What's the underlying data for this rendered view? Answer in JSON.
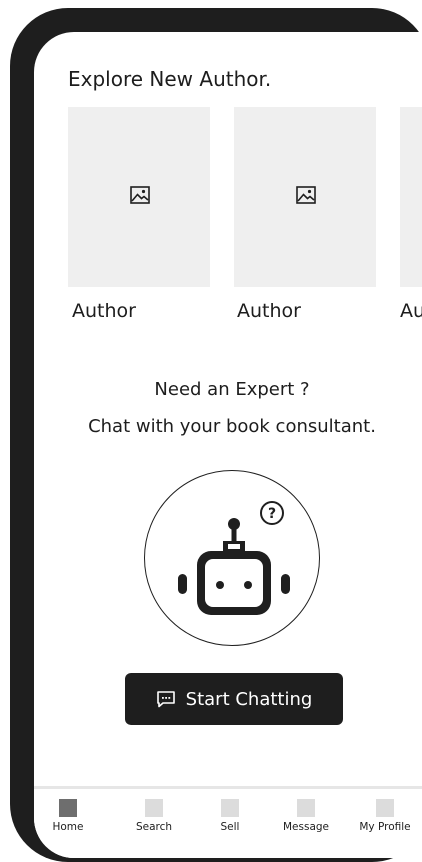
{
  "explore": {
    "title": "Explore New Author.",
    "authors": [
      {
        "name": "Author",
        "image_icon": "image-placeholder-icon"
      },
      {
        "name": "Author",
        "image_icon": "image-placeholder-icon"
      },
      {
        "name": "Au",
        "image_icon": "image-placeholder-icon"
      }
    ]
  },
  "expert": {
    "line1": "Need an Expert ?",
    "line2": "Chat with your book consultant.",
    "illustration_icon": "robot-help-icon",
    "button_label": "Start Chatting",
    "button_icon": "chat-bubble-icon"
  },
  "nav": {
    "items": [
      {
        "label": "Home",
        "active": true
      },
      {
        "label": "Search",
        "active": false
      },
      {
        "label": "Sell",
        "active": false
      },
      {
        "label": "Message",
        "active": false
      },
      {
        "label": "My Profile",
        "active": false
      }
    ]
  },
  "colors": {
    "frame": "#1e1e1e",
    "card": "#efefef",
    "button": "#1e1e1e",
    "nav_active": "#6e6e6e",
    "nav_inactive": "#dcdcdc"
  }
}
